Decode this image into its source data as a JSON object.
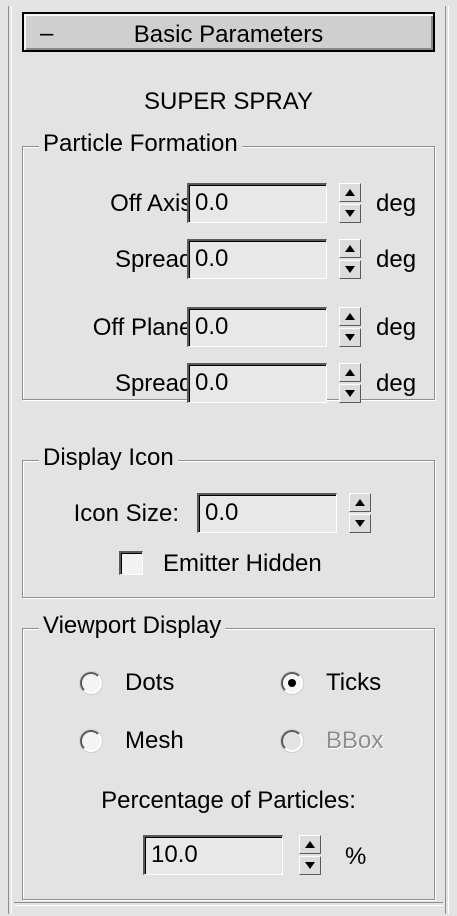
{
  "rollout": {
    "collapse_symbol": "–",
    "title": "Basic Parameters"
  },
  "object_name": "SUPER SPRAY",
  "particle_formation": {
    "title": "Particle Formation",
    "off_axis": {
      "label": "Off Axis:",
      "value": "0.0",
      "unit": "deg"
    },
    "off_axis_spread": {
      "label": "Spread:",
      "value": "0.0",
      "unit": "deg"
    },
    "off_plane": {
      "label": "Off Plane:",
      "value": "0.0",
      "unit": "deg"
    },
    "off_plane_spread": {
      "label": "Spread:",
      "value": "0.0",
      "unit": "deg"
    }
  },
  "display_icon": {
    "title": "Display Icon",
    "icon_size": {
      "label": "Icon Size:",
      "value": "0.0"
    },
    "emitter_hidden": {
      "label": "Emitter Hidden",
      "checked": false
    }
  },
  "viewport_display": {
    "title": "Viewport Display",
    "options": [
      {
        "label": "Dots",
        "selected": false,
        "enabled": true
      },
      {
        "label": "Ticks",
        "selected": true,
        "enabled": true
      },
      {
        "label": "Mesh",
        "selected": false,
        "enabled": true
      },
      {
        "label": "BBox",
        "selected": false,
        "enabled": false
      }
    ],
    "percentage_label": "Percentage of Particles:",
    "percentage_value": "10.0",
    "percentage_unit": "%"
  }
}
